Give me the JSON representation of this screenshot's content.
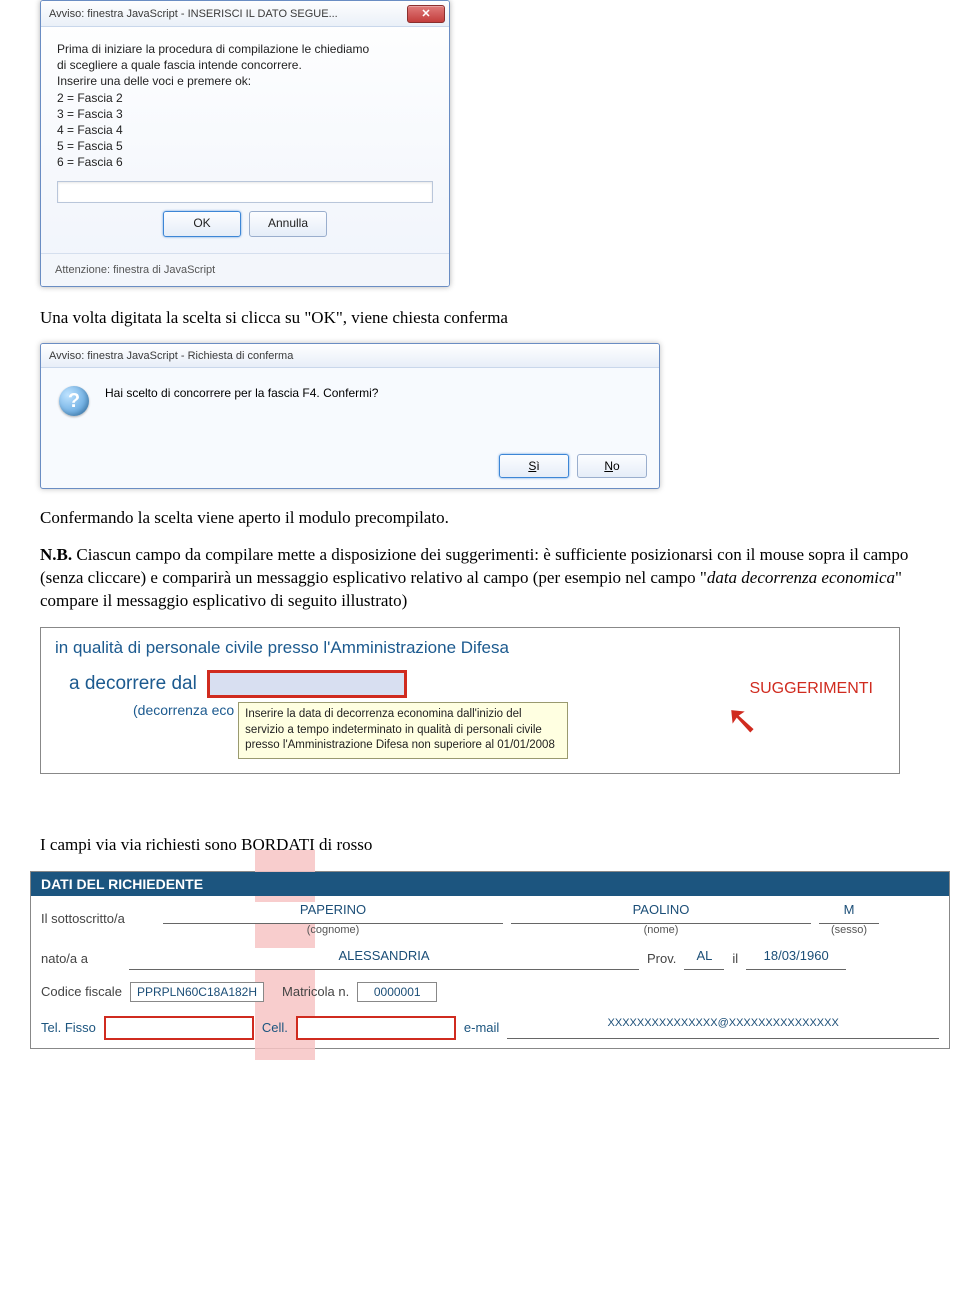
{
  "dialog1": {
    "title": "Avviso: finestra JavaScript - INSERISCI IL DATO SEGUE...",
    "text": "Prima di iniziare la procedura di compilazione le chiediamo\ndi scegliere a quale fascia intende concorrere.\nInserire una delle voci e premere ok:\n2 = Fascia 2\n3 = Fascia 3\n4 = Fascia 4\n5 = Fascia 5\n6 = Fascia 6",
    "input_value": "",
    "ok": "OK",
    "cancel": "Annulla",
    "status": "Attenzione: finestra di JavaScript"
  },
  "doc": {
    "p1": "Una volta digitata la scelta si clicca su \"OK\", viene chiesta conferma",
    "p2": "Confermando la scelta viene aperto il modulo precompilato.",
    "p3_a": "N.B.",
    "p3_b": " Ciascun campo da compilare mette a disposizione dei suggerimenti: è sufficiente posizionarsi con il mouse sopra il campo (senza cliccare) e comparirà un messaggio esplicativo relativo al campo (per esempio nel campo \"",
    "p3_c": "data decorrenza economica",
    "p3_d": "\" compare il messaggio esplicativo di seguito illustrato)",
    "p4": "I campi via via richiesti sono BORDATI di rosso"
  },
  "dialog2": {
    "title": "Avviso: finestra JavaScript - Richiesta di conferma",
    "msg": "Hai scelto di concorrere per la fascia F4. Confermi?",
    "yes_u": "S",
    "yes_r": "ì",
    "no_u": "N",
    "no_r": "o"
  },
  "hint": {
    "line1": "in qualità di personale civile presso l'Amministrazione Difesa",
    "label": "a decorrere dal",
    "sub": "(decorrenza eco",
    "tooltip": "Inserire la data di decorrenza economina dall'inizio del servizio a tempo indeterminato in qualità di personali civile presso l'Amministrazione Difesa non superiore al 01/01/2008",
    "sugg": "SUGGERIMENTI"
  },
  "form": {
    "header": "DATI DEL RICHIEDENTE",
    "l_sottoscr": "Il sottoscritto/a",
    "cognome": "PAPERINO",
    "cognome_cap": "(cognome)",
    "nome": "PAOLINO",
    "nome_cap": "(nome)",
    "sesso": "M",
    "sesso_cap": "(sesso)",
    "l_nato": "nato/a a",
    "luogo": "ALESSANDRIA",
    "l_prov": "Prov.",
    "prov": "AL",
    "l_il": "il",
    "data": "18/03/1960",
    "l_cf": "Codice fiscale",
    "cf": "PPRPLN60C18A182H",
    "l_matr": "Matricola n.",
    "matr": "0000001",
    "l_tel": "Tel. Fisso",
    "l_cell": "Cell.",
    "l_email": "e-mail",
    "email": "XXXXXXXXXXXXXXX@XXXXXXXXXXXXXXX"
  }
}
